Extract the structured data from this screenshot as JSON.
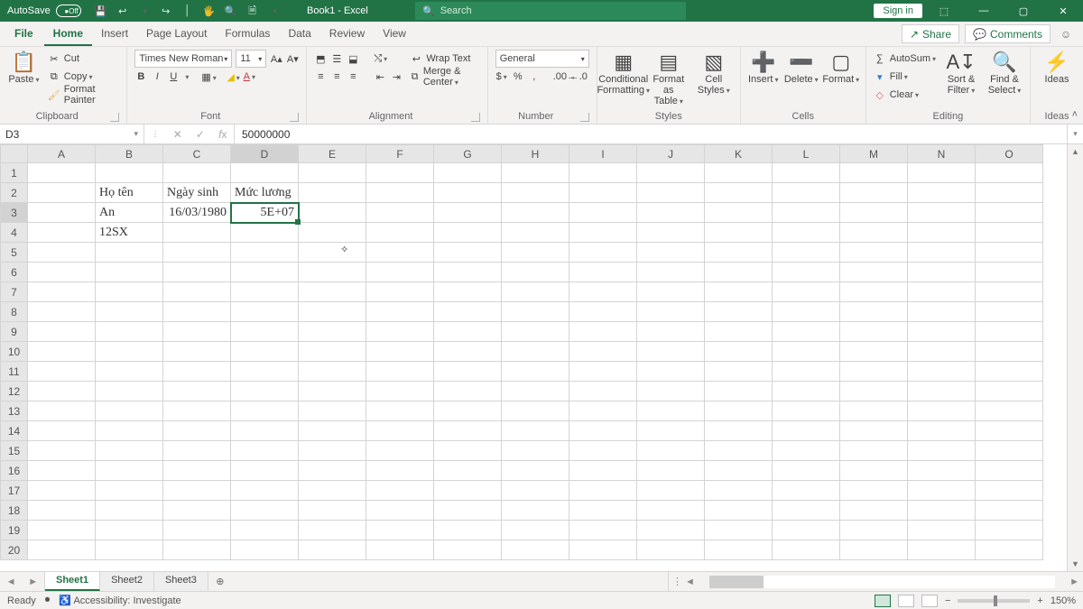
{
  "title": {
    "autosave": "AutoSave",
    "autosave_state": "Off",
    "doc": "Book1  -  Excel",
    "search": "Search",
    "signin": "Sign in"
  },
  "tabs": {
    "file": "File",
    "items": [
      "Home",
      "Insert",
      "Page Layout",
      "Formulas",
      "Data",
      "Review",
      "View"
    ],
    "active": 0,
    "share": "Share",
    "comments": "Comments"
  },
  "ribbon": {
    "clipboard": {
      "paste": "Paste",
      "cut": "Cut",
      "copy": "Copy",
      "painter": "Format Painter",
      "label": "Clipboard"
    },
    "font": {
      "name": "Times New Roman",
      "size": "11",
      "label": "Font"
    },
    "alignment": {
      "wrap": "Wrap Text",
      "merge": "Merge & Center",
      "label": "Alignment"
    },
    "number": {
      "format": "General",
      "label": "Number"
    },
    "styles": {
      "cond": "Conditional Formatting",
      "table": "Format as Table",
      "cell": "Cell Styles",
      "label": "Styles"
    },
    "cells": {
      "insert": "Insert",
      "delete": "Delete",
      "format": "Format",
      "label": "Cells"
    },
    "editing": {
      "sum": "AutoSum",
      "fill": "Fill",
      "clear": "Clear",
      "sort": "Sort & Filter",
      "find": "Find & Select",
      "label": "Editing"
    },
    "ideas": {
      "btn": "Ideas",
      "label": "Ideas"
    }
  },
  "fbar": {
    "name": "D3",
    "formula": "50000000"
  },
  "columns": [
    "A",
    "B",
    "C",
    "D",
    "E",
    "F",
    "G",
    "H",
    "I",
    "J",
    "K",
    "L",
    "M",
    "N",
    "O"
  ],
  "rows": 20,
  "selection": {
    "col": 3,
    "row": 2
  },
  "cells": {
    "B2": "Họ tên",
    "C2": "Ngày sinh",
    "D2": "Mức lương",
    "B3": "An",
    "C3": "16/03/1980",
    "D3": "5E+07",
    "B4": "12SX"
  },
  "right_align": [
    "C3",
    "D3"
  ],
  "sheets": {
    "items": [
      "Sheet1",
      "Sheet2",
      "Sheet3"
    ],
    "active": 0
  },
  "status": {
    "ready": "Ready",
    "acc": "Accessibility: Investigate",
    "zoom": "150%"
  }
}
